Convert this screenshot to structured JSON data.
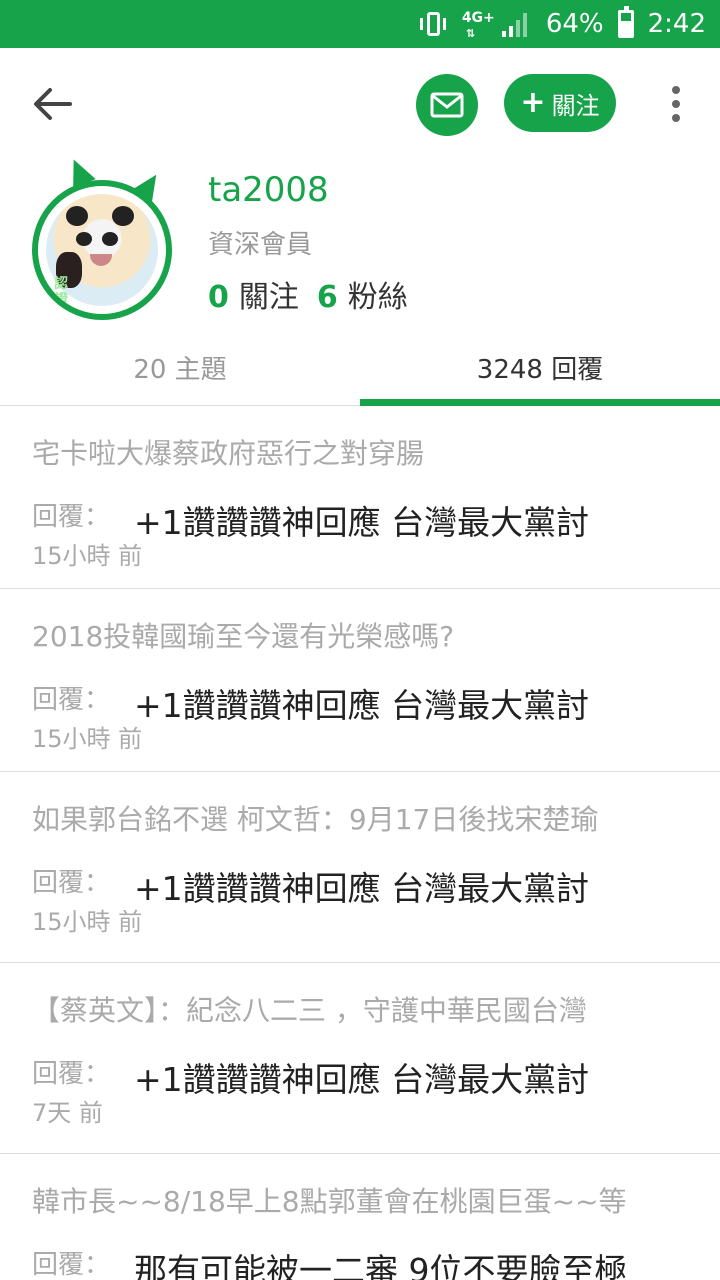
{
  "statusbar": {
    "network": "4G+",
    "battery_percent": "64%",
    "battery_level": 0.64,
    "time": "2:42",
    "icons": [
      "vibrate-icon",
      "network-icon",
      "signal-icon",
      "battery-icon"
    ]
  },
  "toolbar": {
    "back_icon": "arrow-left-icon",
    "mail_icon": "envelope-icon",
    "follow_label": "關注",
    "follow_plus": "+",
    "more_icon": "more-vertical-icon"
  },
  "profile": {
    "username": "ta2008",
    "rank": "資深會員",
    "avatar_badge": "認\n證",
    "following_count": "0",
    "following_label": "關注",
    "followers_count": "6",
    "followers_label": "粉絲"
  },
  "tabs": [
    {
      "label": "20 主題",
      "active": false
    },
    {
      "label": "3248 回覆",
      "active": true
    }
  ],
  "colors": {
    "accent": "#16a34a",
    "muted_text": "#aaaaaa",
    "primary_text": "#222222"
  },
  "replies": [
    {
      "title": "宅卡啦大爆蔡政府惡行之對穿腸",
      "label": "回覆：",
      "text": "+1讚讚讚神回應 台灣最大黨討",
      "time": "15小時 前"
    },
    {
      "title": "2018投韓國瑜至今還有光榮感嗎?",
      "label": "回覆：",
      "text": "+1讚讚讚神回應 台灣最大黨討",
      "time": "15小時 前"
    },
    {
      "title": "如果郭台銘不選 柯文哲：9月17日後找宋楚瑜",
      "label": "回覆：",
      "text": "+1讚讚讚神回應 台灣最大黨討",
      "time": "15小時 前"
    },
    {
      "title": "【蔡英文】：紀念八二三 ，守護中華民國台灣",
      "label": "回覆：",
      "text": "+1讚讚讚神回應 台灣最大黨討",
      "time": "7天 前"
    },
    {
      "title": "韓市長~~8/18早上8點郭董會在桃園巨蛋~~等",
      "label": "回覆：",
      "text": "那有可能被一二審 9位不要臉至極",
      "time": ""
    }
  ]
}
